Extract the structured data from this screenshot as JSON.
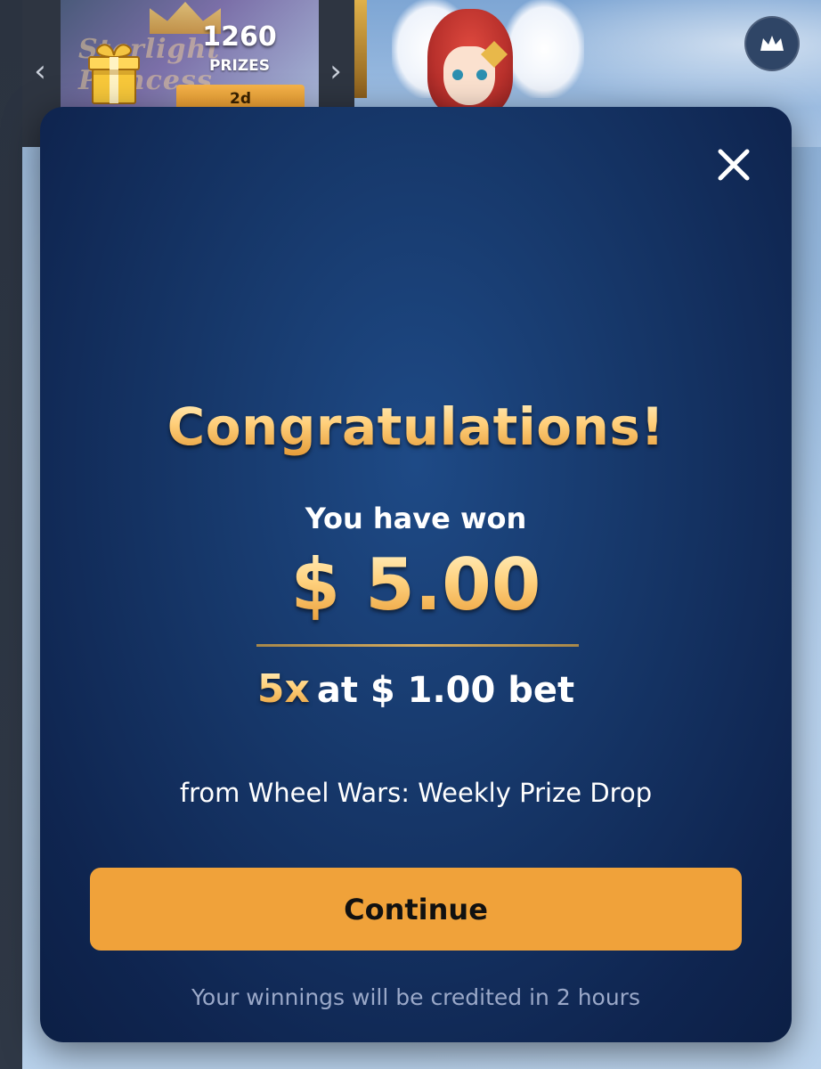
{
  "background": {
    "prize_banner": {
      "count": "1260",
      "label": "PRIZES",
      "time_left": "2d",
      "banner_text": "Starlight Princess",
      "prev_icon": "chevron-left-icon",
      "next_icon": "chevron-right-icon",
      "gift_icon": "gift-icon"
    },
    "corner_button_icon": "crown-icon"
  },
  "modal": {
    "close_icon": "close-icon",
    "title": "Congratulations!",
    "subtitle": "You have won",
    "amount": "$ 5.00",
    "multiplier": "5x",
    "bet_text": "at $ 1.00 bet",
    "source": "from Wheel Wars: Weekly Prize Drop",
    "continue_label": "Continue",
    "footnote": "Your winnings will be credited in 2 hours"
  },
  "colors": {
    "modal_bg": "#17396c",
    "gold": "#ffcf7d",
    "button": "#f0a23a",
    "footnote": "#9aa8c8"
  }
}
